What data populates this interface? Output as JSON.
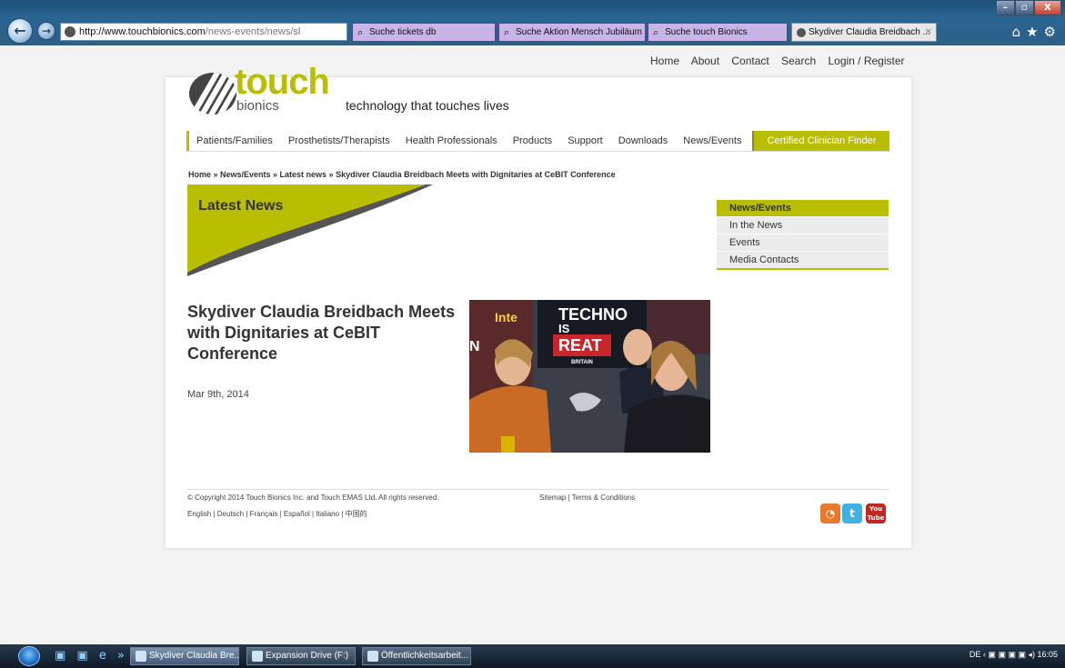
{
  "browser": {
    "address_domain": "http://www.touchbionics.com",
    "address_path": "/news-events/news/sl",
    "address_tools": "⌕ ▾ ▤ ↻ ✕",
    "tabs": [
      {
        "label": "Suche tickets db"
      },
      {
        "label": "Suche Aktion Mensch Jubiläum"
      },
      {
        "label": "Suche touch Bionics"
      },
      {
        "label": "Skydiver Claudia Breidbach ..."
      }
    ],
    "window_controls": [
      "–",
      "▫",
      "X"
    ],
    "right_icons": "⌂★⚙"
  },
  "site": {
    "top_links": [
      "Home",
      "About",
      "Contact",
      "Search",
      "Login / Register"
    ],
    "logo_word": "touch",
    "logo_sub": "bionics",
    "tagline": "technology that touches lives",
    "nav": [
      "Patients/Families",
      "Prosthetists/Therapists",
      "Health Professionals",
      "Products",
      "Support",
      "Downloads",
      "News/Events"
    ],
    "clinician_button": "Certified Clinician Finder",
    "breadcrumb": "Home » News/Events » Latest news » Skydiver Claudia Breidbach Meets with Dignitaries at CeBIT Conference",
    "hero_title": "Latest News",
    "side_menu": {
      "header": "News/Events",
      "items": [
        "In the News",
        "Events",
        "Media Contacts"
      ]
    },
    "article": {
      "title": "Skydiver Claudia Breidbach Meets with Dignitaries at CeBIT Conference",
      "date": "Mar 9th, 2014",
      "photo_text_1": "TECHNO",
      "photo_text_2": "IS",
      "photo_text_3": "REAT",
      "photo_text_4": "BRITAIN",
      "photo_text_5": "Inte",
      "photo_text_6": "N"
    },
    "footer": {
      "copyright": "© Copyright 2014 Touch Bionics Inc. and Touch EMAS Ltd. All rights reserved.",
      "languages": "English | Deutsch | Français | Español | Italiano | 中国的",
      "links": "Sitemap | Terms & Conditions",
      "youtube_label": "You Tube"
    }
  },
  "taskbar": {
    "quick_launch": "▣ ▣ e »",
    "tasks": [
      {
        "label": "Skydiver Claudia Bre..."
      },
      {
        "label": "Expansion Drive (F:)"
      },
      {
        "label": "Öffentlichkeitsarbeit..."
      }
    ],
    "tray_lang": "DE",
    "clock": "16:05"
  },
  "colors": {
    "brand_green": "#b9be00",
    "chrome_blue": "#2a6592",
    "tab_purple": "#c9b4e8"
  }
}
